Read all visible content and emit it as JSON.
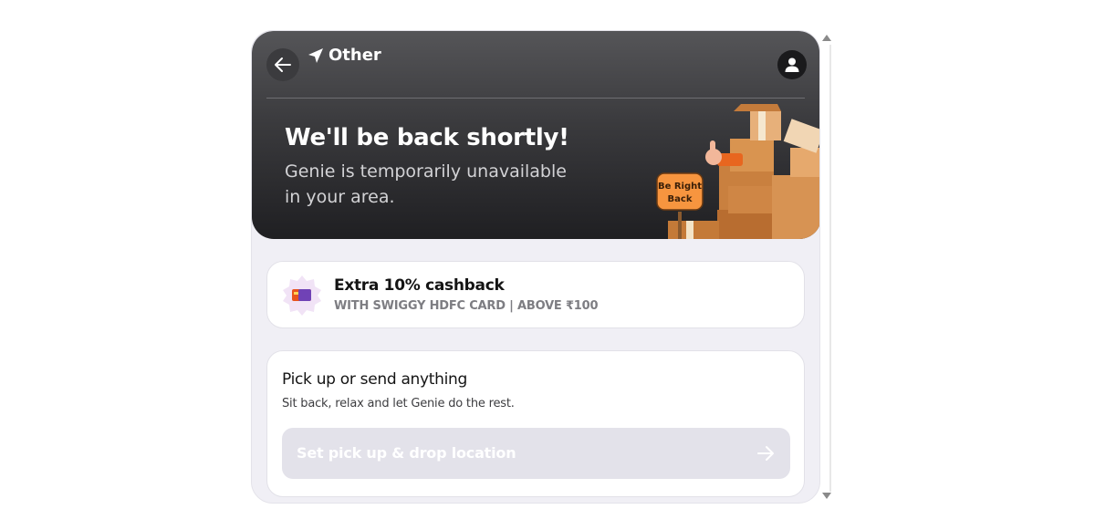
{
  "header": {
    "location_label": "Other",
    "title": "We'll be back shortly!",
    "subtitle": "Genie is temporarily unavailable in your area.",
    "sign_text": "Be Right Back"
  },
  "offer": {
    "title": "Extra 10% cashback",
    "subtitle": "WITH SWIGGY HDFC CARD | ABOVE ₹100"
  },
  "pick": {
    "title": "Pick up or send anything",
    "subtitle": "Sit back, relax and let Genie do the rest.",
    "button_label": "Set pick up & drop location"
  },
  "icons": {
    "back": "arrow-left-icon",
    "location": "navigation-arrow-icon",
    "profile": "user-icon",
    "offer": "card-badge-icon",
    "forward": "arrow-right-icon"
  },
  "colors": {
    "header_top": "#555558",
    "header_bottom": "#1f1f22",
    "page_bg": "#f0eff5",
    "button_bg": "#e3e2ea",
    "badge_bg": "#f1e3f6",
    "sign_orange": "#f7953f"
  }
}
